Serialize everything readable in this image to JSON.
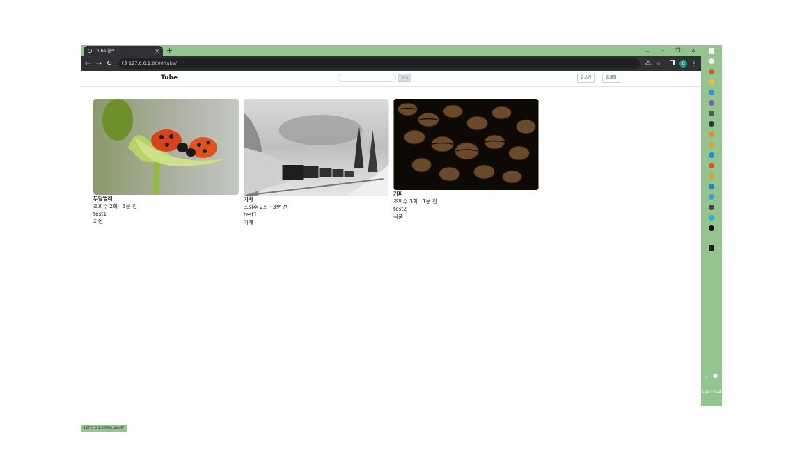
{
  "browser": {
    "tab_title": "Tube 블로그",
    "tab_close": "×",
    "new_tab": "+",
    "url_host": "127.0.0.1",
    "url_path": ":8000/tube/",
    "window_minimize": "⌄",
    "window_min": "–",
    "window_restore": "❐",
    "window_close": "✕",
    "back": "←",
    "forward": "→",
    "reload": "↻",
    "avatar_letter": "C",
    "status_url": "127.0.0.1:8000/tube/6/"
  },
  "navbar": {
    "brand": "Tube",
    "search_placeholder": "",
    "search_button": "검색",
    "write_button": "글쓰기",
    "profile_button": "프로필"
  },
  "videos": [
    {
      "title": "무당벌레",
      "meta": "조회수 2회 · 3분 전",
      "author": "test1",
      "category": "자연",
      "image": "ladybugs-on-leaf"
    },
    {
      "title": "기차",
      "meta": "조회수 2회 · 3분 전",
      "author": "test1",
      "category": "기계",
      "image": "steam-train-in-winter-forest"
    },
    {
      "title": "커피",
      "meta": "조회수 3회 · 1분 전",
      "author": "test2",
      "category": "식품",
      "image": "coffee-beans"
    }
  ],
  "taskbar": {
    "time": "오후 12:44"
  },
  "colors": {
    "chrome_dark": "#303134",
    "frame_green": "#95c58f"
  }
}
